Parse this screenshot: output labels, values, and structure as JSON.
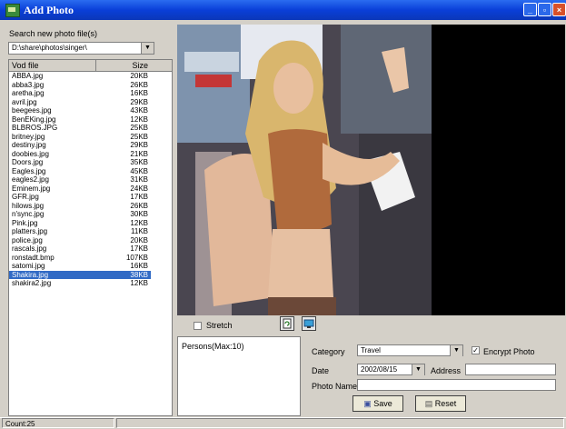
{
  "window": {
    "title": "Add Photo"
  },
  "left": {
    "search_label": "Search new photo file(s)",
    "path": "D:\\share\\photos\\singer\\",
    "list_headers": {
      "file": "Vod file",
      "size": "Size"
    },
    "files": [
      {
        "name": "ABBA.jpg",
        "size": "20KB"
      },
      {
        "name": "abba3.jpg",
        "size": "26KB"
      },
      {
        "name": "aretha.jpg",
        "size": "16KB"
      },
      {
        "name": "avril.jpg",
        "size": "29KB"
      },
      {
        "name": "beegees.jpg",
        "size": "43KB"
      },
      {
        "name": "BenEKing.jpg",
        "size": "12KB"
      },
      {
        "name": "BLBROS.JPG",
        "size": "25KB"
      },
      {
        "name": "britney.jpg",
        "size": "25KB"
      },
      {
        "name": "destiny.jpg",
        "size": "29KB"
      },
      {
        "name": "doobies.jpg",
        "size": "21KB"
      },
      {
        "name": "Doors.jpg",
        "size": "35KB"
      },
      {
        "name": "Eagles.jpg",
        "size": "45KB"
      },
      {
        "name": "eagles2.jpg",
        "size": "31KB"
      },
      {
        "name": "Eminem.jpg",
        "size": "24KB"
      },
      {
        "name": "GFR.jpg",
        "size": "17KB"
      },
      {
        "name": "hilows.jpg",
        "size": "26KB"
      },
      {
        "name": "n'sync.jpg",
        "size": "30KB"
      },
      {
        "name": "Pink.jpg",
        "size": "12KB"
      },
      {
        "name": "platters.jpg",
        "size": "11KB"
      },
      {
        "name": "police.jpg",
        "size": "20KB"
      },
      {
        "name": "rascals.jpg",
        "size": "17KB"
      },
      {
        "name": "ronstadt.bmp",
        "size": "107KB"
      },
      {
        "name": "satomi.jpg",
        "size": "16KB"
      },
      {
        "name": "Shakira.jpg",
        "size": "38KB",
        "selected": true
      },
      {
        "name": "shakira2.jpg",
        "size": "12KB"
      }
    ]
  },
  "viewer": {
    "stretch_label": "Stretch",
    "stretch_checked": false
  },
  "persons": {
    "label": "Persons(Max:10)"
  },
  "form": {
    "category_label": "Category",
    "category_value": "Travel",
    "encrypt_label": "Encrypt Photo",
    "encrypt_checked": true,
    "date_label": "Date",
    "date_value": "2002/08/15",
    "address_label": "Address",
    "address_value": "",
    "photo_name_label": "Photo Name",
    "photo_name_value": "",
    "save_label": "Save",
    "reset_label": "Reset"
  },
  "status": {
    "count": "Count:25"
  },
  "colors": {
    "title_bar": "#0b3fd8",
    "selection": "#316ac5",
    "face": "#d4d0c8"
  }
}
